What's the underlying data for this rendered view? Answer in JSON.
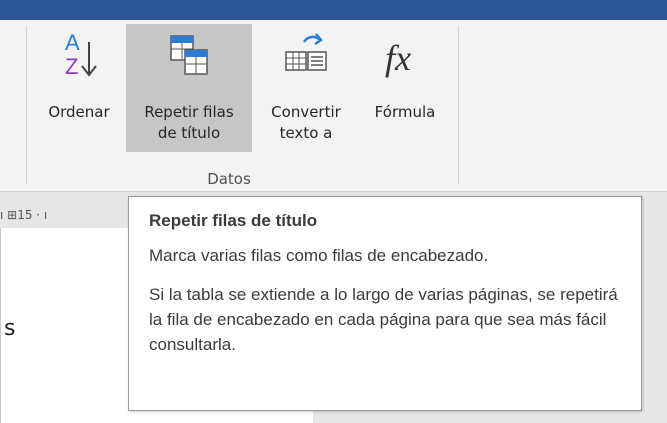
{
  "ribbon": {
    "buttons": [
      {
        "line1": "Ordenar",
        "line2": "",
        "icon": "sort-az-icon"
      },
      {
        "line1": "Repetir filas",
        "line2": "de título",
        "icon": "repeat-header-rows-icon"
      },
      {
        "line1": "Convertir",
        "line2": "texto a",
        "icon": "convert-to-text-icon"
      },
      {
        "line1": "Fórmula",
        "line2": "",
        "icon": "formula-fx-icon"
      }
    ],
    "group_label": "Datos"
  },
  "ruler": {
    "text": "ı  ⊞15 ·  ı"
  },
  "document": {
    "visible_char": "s"
  },
  "tooltip": {
    "title": "Repetir filas de título",
    "description": "Marca varias filas como filas de encabezado.",
    "detail": "Si la tabla se extiende a lo largo de varias páginas, se repetirá la fila de encabezado en cada página para que sea más fácil consultarla."
  },
  "colors": {
    "titlebar": "#2b579a",
    "ribbon_bg": "#f3f3f3",
    "hover_bg": "#c6c6c6",
    "accent_blue": "#2b7cd3",
    "accent_purple": "#8b3db3"
  }
}
